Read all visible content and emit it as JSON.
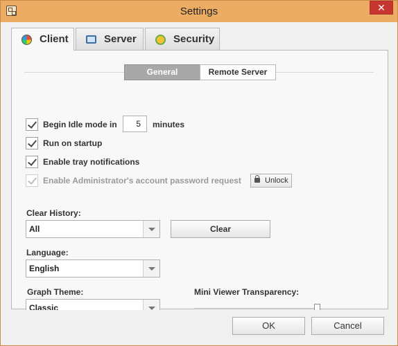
{
  "window": {
    "title": "Settings",
    "close_label": "✕"
  },
  "tabs": [
    {
      "label": "Client",
      "icon": "client-icon",
      "active": true
    },
    {
      "label": "Server",
      "icon": "monitor-icon",
      "active": false
    },
    {
      "label": "Security",
      "icon": "security-icon",
      "active": false
    }
  ],
  "subtabs": [
    {
      "label": "General",
      "active": true
    },
    {
      "label": "Remote Server",
      "active": false
    }
  ],
  "options": {
    "idle": {
      "label": "Begin Idle mode in",
      "value": "5",
      "suffix": "minutes",
      "checked": true
    },
    "startup": {
      "label": "Run on startup",
      "checked": true
    },
    "tray": {
      "label": "Enable tray notifications",
      "checked": true
    },
    "admin": {
      "label": "Enable Administrator's account password request",
      "checked": true,
      "disabled": true
    },
    "unlock_label": "Unlock"
  },
  "clear_history": {
    "label": "Clear History:",
    "selected": "All",
    "button": "Clear"
  },
  "language": {
    "label": "Language:",
    "selected": "English"
  },
  "graph_theme": {
    "label": "Graph Theme:",
    "selected": "Classic"
  },
  "mini_viewer": {
    "label": "Mini Viewer Transparency:",
    "value_fraction": 1.0
  },
  "footer": {
    "ok": "OK",
    "cancel": "Cancel"
  },
  "colors": {
    "titlebar": "#ecac63",
    "close": "#c7372f",
    "selected_segment": "#a8a8a8"
  }
}
